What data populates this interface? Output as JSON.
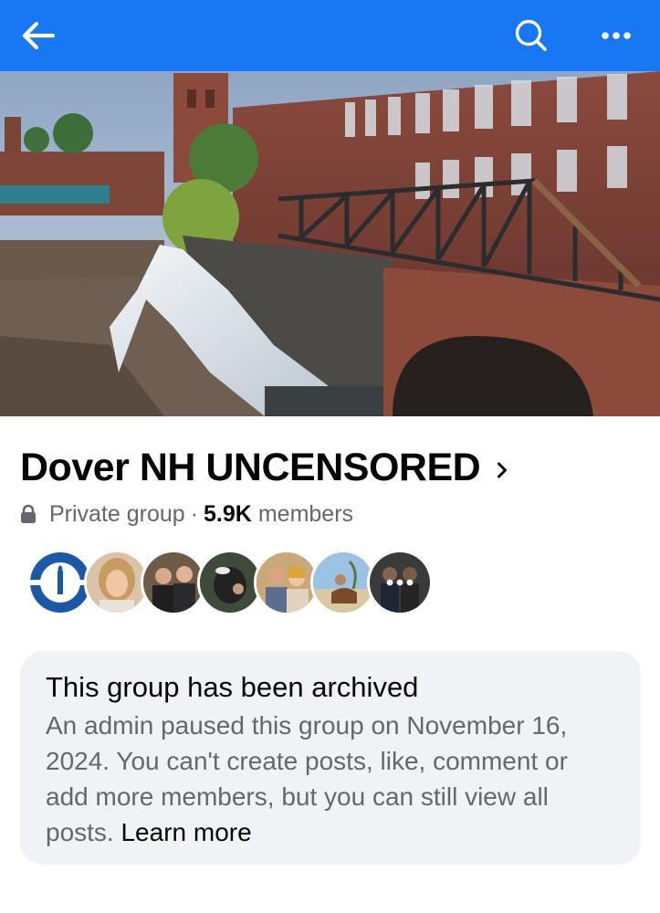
{
  "topbar": {
    "back_icon": "arrow-left-icon",
    "search_icon": "search-icon",
    "more_icon": "more-horizontal-icon",
    "background": "#1877f2"
  },
  "cover": {
    "image": "cover-photo-mill-waterfall-bridge"
  },
  "group": {
    "name": "Dover NH UNCENSORED",
    "privacy": "Private group",
    "separator": "·",
    "member_count": "5.9K",
    "members_label": "members"
  },
  "members_preview": {
    "avatars": [
      "member-avatar-1",
      "member-avatar-2",
      "member-avatar-3",
      "member-avatar-4",
      "member-avatar-5",
      "member-avatar-6",
      "member-avatar-7"
    ],
    "more_icon": "more-horizontal-icon"
  },
  "archived_notice": {
    "title": "This group has been archived",
    "body": "An admin paused this group on November 16, 2024. You can't create posts, like, comment or add more members, but you can still view all posts.",
    "link": "Learn more"
  }
}
